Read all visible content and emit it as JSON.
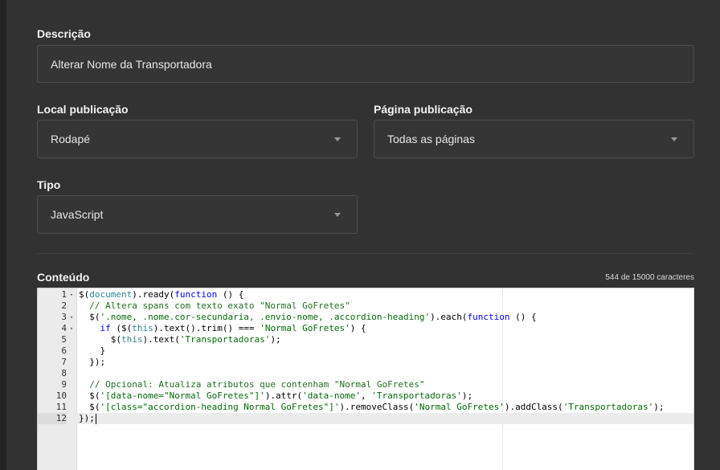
{
  "form": {
    "descricao": {
      "label": "Descrição",
      "value": "Alterar Nome da Transportadora"
    },
    "local": {
      "label": "Local publicação",
      "value": "Rodapé"
    },
    "pagina": {
      "label": "Página publicação",
      "value": "Todas as páginas"
    },
    "tipo": {
      "label": "Tipo",
      "value": "JavaScript"
    },
    "conteudo": {
      "label": "Conteúdo",
      "counter": "544 de 15000 caracteres"
    }
  },
  "editor": {
    "lines": [
      {
        "n": "1",
        "fold": "▾",
        "text": "$(document).ready(function () {"
      },
      {
        "n": "2",
        "fold": "",
        "text": "  // Altera spans com texto exato \"Normal GoFretes\""
      },
      {
        "n": "3",
        "fold": "▾",
        "text": "  $('.nome, .nome.cor-secundaria, .envio-nome, .accordion-heading').each(function () {"
      },
      {
        "n": "4",
        "fold": "▾",
        "text": "    if ($(this).text().trim() === 'Normal GoFretes') {"
      },
      {
        "n": "5",
        "fold": "",
        "text": "      $(this).text('Transportadoras');"
      },
      {
        "n": "6",
        "fold": "",
        "text": "    }"
      },
      {
        "n": "7",
        "fold": "",
        "text": "  });"
      },
      {
        "n": "8",
        "fold": "",
        "text": ""
      },
      {
        "n": "9",
        "fold": "",
        "text": "  // Opcional: Atualiza atributos que contenham \"Normal GoFretes\""
      },
      {
        "n": "10",
        "fold": "",
        "text": "  $('[data-nome=\"Normal GoFretes\"]').attr('data-nome', 'Transportadoras');"
      },
      {
        "n": "11",
        "fold": "",
        "text": "  $('[class=\"accordion-heading Normal GoFretes\"]').removeClass('Normal GoFretes').addClass('Transportadoras');"
      },
      {
        "n": "12",
        "fold": "",
        "text": "});"
      }
    ],
    "active_line": 12
  },
  "colors": {
    "keyword": "#0000ff",
    "comment": "#236e24",
    "string": "#036a07",
    "variable": "#318495"
  }
}
